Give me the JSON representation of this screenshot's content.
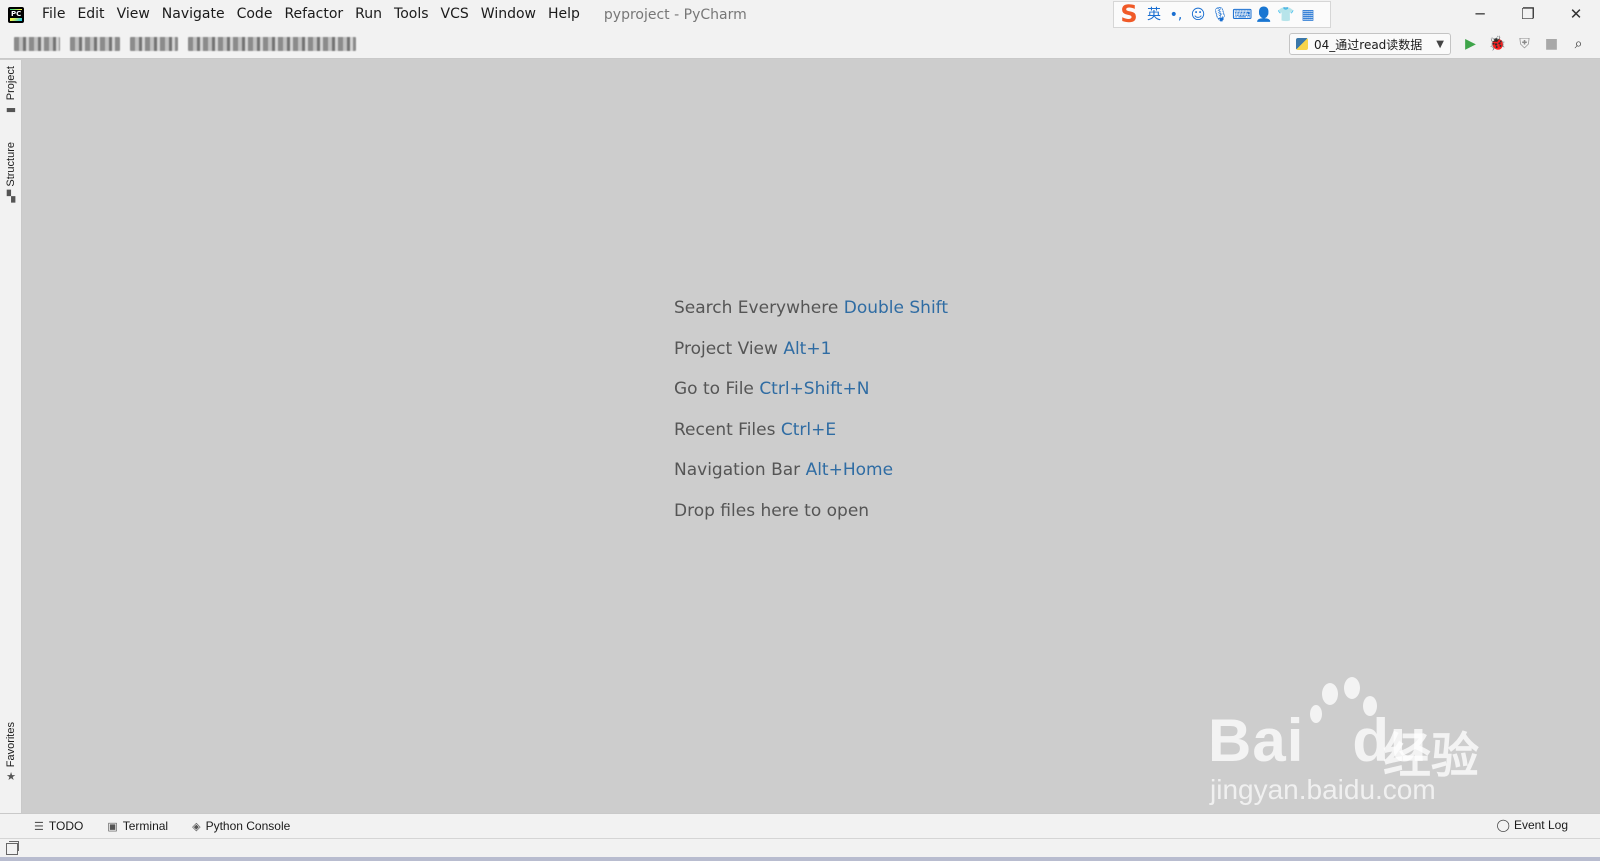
{
  "titlebar": {
    "app_icon": "pycharm-logo-icon",
    "window_title": "pyproject - PyCharm",
    "menu": [
      "File",
      "Edit",
      "View",
      "Navigate",
      "Code",
      "Refactor",
      "Run",
      "Tools",
      "VCS",
      "Window",
      "Help"
    ],
    "ime": {
      "logo": "S",
      "mode": "英",
      "icons": [
        "punctuation-icon",
        "emoji-icon",
        "microphone-icon",
        "keyboard-icon",
        "user-icon",
        "skin-icon",
        "toolbox-icon"
      ]
    },
    "window_controls": {
      "minimize": "─",
      "restore": "❐",
      "close": "✕"
    }
  },
  "toolbar": {
    "run_config": "04_通过read读数据",
    "icons": {
      "run": "▶",
      "debug": "🐞",
      "coverage": "⛨",
      "stop": "■",
      "search": "⌕"
    }
  },
  "left_strip": {
    "tabs": [
      {
        "label": "Project",
        "icon": "folder-icon"
      },
      {
        "label": "Structure",
        "icon": "structure-icon"
      },
      {
        "label": "Favorites",
        "icon": "star-icon"
      }
    ]
  },
  "editor": {
    "hints": [
      {
        "text": "Search Everywhere",
        "key": "Double Shift"
      },
      {
        "text": "Project View",
        "key": "Alt+1"
      },
      {
        "text": "Go to File",
        "key": "Ctrl+Shift+N"
      },
      {
        "text": "Recent Files",
        "key": "Ctrl+E"
      },
      {
        "text": "Navigation Bar",
        "key": "Alt+Home"
      },
      {
        "text": "Drop files here to open",
        "key": ""
      }
    ]
  },
  "watermark": {
    "brand": "Bai",
    "brand_tail": "du",
    "cn": "经验",
    "url": "jingyan.baidu.com"
  },
  "bottom_strip": {
    "tabs": [
      {
        "label": "TODO",
        "icon": "list-icon"
      },
      {
        "label": "Terminal",
        "icon": "terminal-icon"
      },
      {
        "label": "Python Console",
        "icon": "python-icon"
      }
    ],
    "event_log": "Event Log"
  },
  "colors": {
    "chrome": "#f2f2f2",
    "editor_bg": "#cdcdcd",
    "hint_text": "#555555",
    "hint_key": "#2f6ca3",
    "run_green": "#3fa54a"
  }
}
